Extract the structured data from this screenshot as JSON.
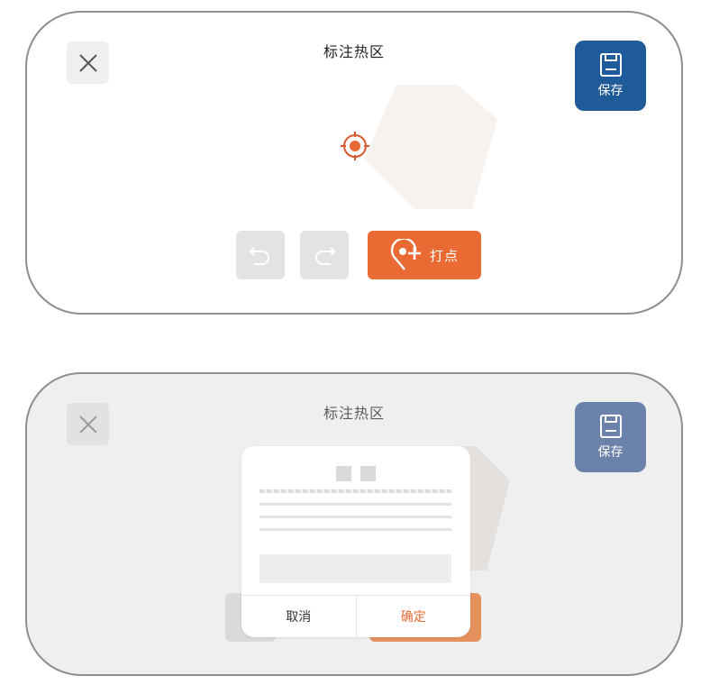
{
  "screens": [
    {
      "title": "标注热区",
      "save_label": "保存",
      "mark_label": "打点",
      "icons": {
        "close": "close-icon",
        "save": "floppy-disk-icon",
        "target": "target-crosshair-icon",
        "undo": "undo-icon",
        "redo": "redo-icon",
        "add_point": "location-add-icon"
      }
    },
    {
      "title": "标注热区",
      "save_label": "保存",
      "dialog": {
        "cancel_label": "取消",
        "confirm_label": "确定"
      }
    }
  ],
  "colors": {
    "primary_blue": "#1f5a99",
    "accent_orange": "#e96a32",
    "hotzone_fill": "#f7f2ee",
    "muted_button": "#e3e3e3"
  }
}
